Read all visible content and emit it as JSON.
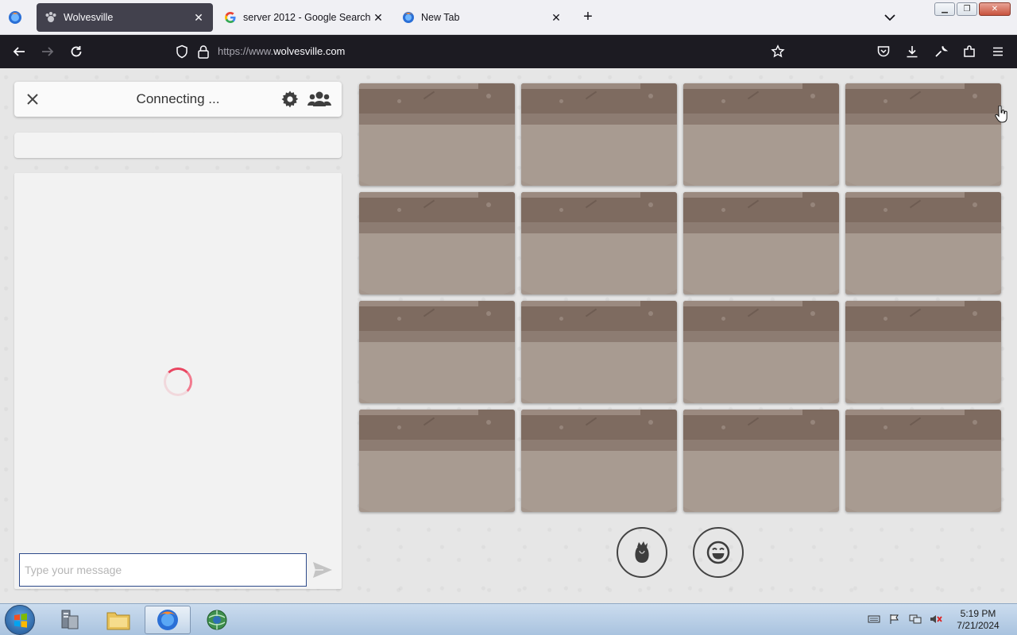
{
  "browser": {
    "tabs": [
      {
        "label": "Wolvesville",
        "active": true,
        "icon": "wolf-paw-icon"
      },
      {
        "label": "server 2012 - Google Search",
        "active": false,
        "icon": "google-icon"
      },
      {
        "label": "New Tab",
        "active": false,
        "icon": "firefox-icon"
      }
    ],
    "url_prefix": "https://www.",
    "url_domain": "wolvesville.com"
  },
  "chat": {
    "status": "Connecting ...",
    "input_placeholder": "Type your message",
    "input_value": ""
  },
  "players": {
    "slot_count": 16,
    "columns": 4
  },
  "actions": [
    {
      "name": "rose-button",
      "icon": "rose-icon"
    },
    {
      "name": "emoji-button",
      "icon": "smiley-icon"
    }
  ],
  "taskbar": {
    "time": "5:19 PM",
    "date": "7/21/2024"
  },
  "colors": {
    "card_background": "#a4968c",
    "card_header": "#7e6b60",
    "spinner": "#e94560",
    "input_border": "#2d4a8a",
    "active_tab": "#42414d"
  }
}
